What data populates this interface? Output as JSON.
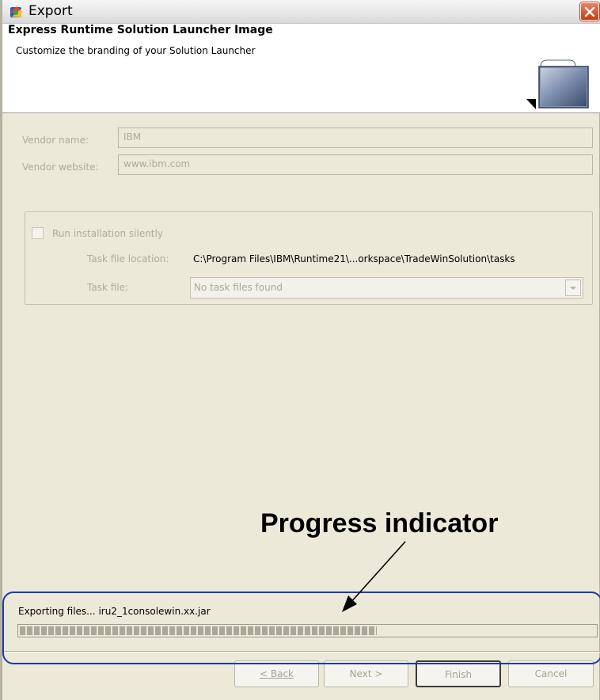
{
  "window": {
    "title": "Export"
  },
  "header": {
    "title": "Express Runtime Solution Launcher Image",
    "description": "Customize the branding of your Solution Launcher"
  },
  "form": {
    "vendor_name_label": "Vendor name:",
    "vendor_name_value": "IBM",
    "vendor_website_label": "Vendor website:",
    "vendor_website_value": "www.ibm.com",
    "run_silently_label": "Run installation silently",
    "run_silently_checked": false,
    "task_file_location_label": "Task file location:",
    "task_file_location_value": "C:\\Program Files\\IBM\\Runtime21\\...orkspace\\TradeWinSolution\\tasks",
    "task_file_label": "Task file:",
    "task_file_selected": "No task files found"
  },
  "progress": {
    "status": "Exporting files... iru2_1consolewin.xx.jar",
    "fraction": 0.62
  },
  "buttons": {
    "back": "< Back",
    "next": "Next >",
    "finish": "Finish",
    "cancel": "Cancel"
  },
  "annotation": {
    "label": "Progress indicator"
  },
  "colors": {
    "annotation_outline": "#1f39b0",
    "close_button": "#d9542c",
    "dialog_background": "#ece9d8"
  }
}
